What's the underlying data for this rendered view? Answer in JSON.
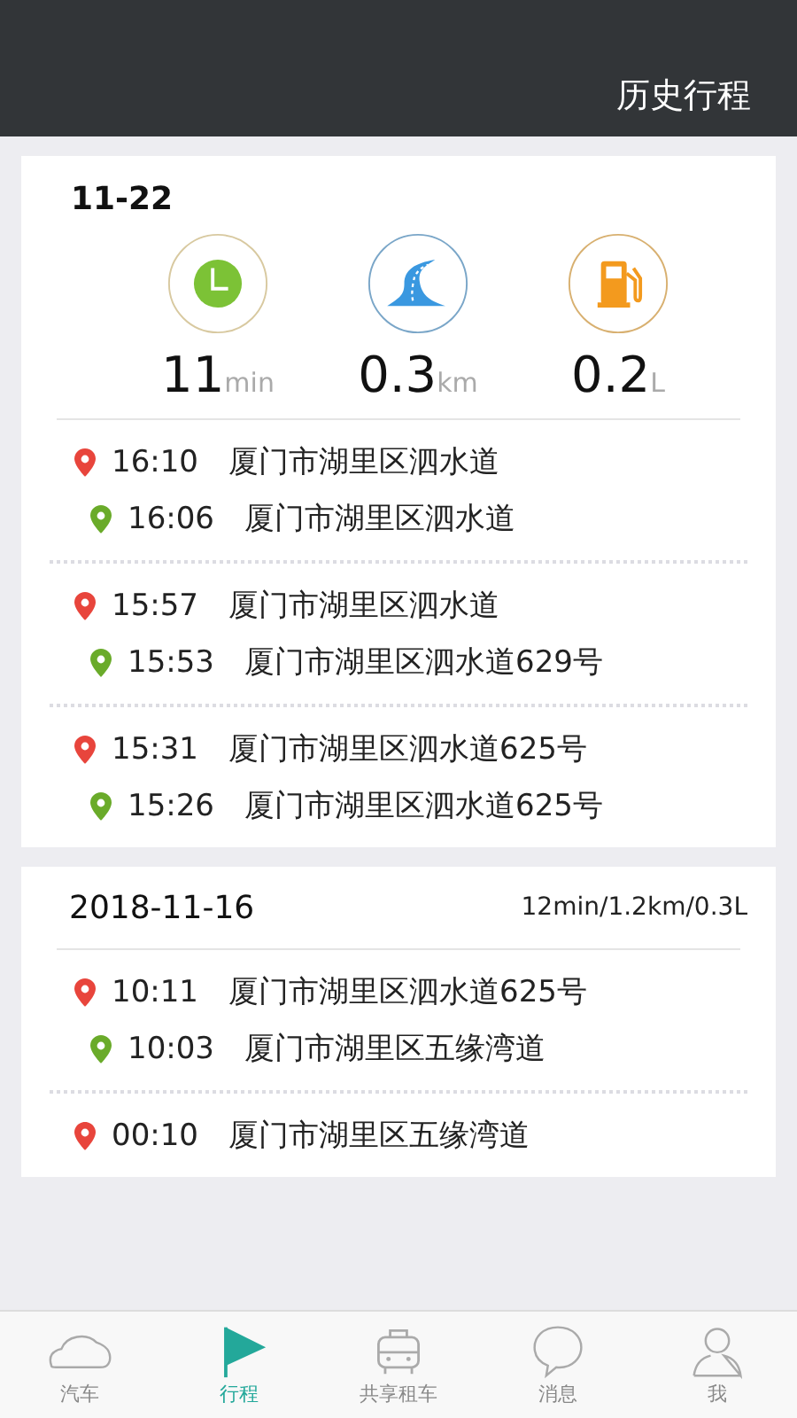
{
  "header": {
    "title": "历史行程"
  },
  "days": [
    {
      "date": "11-22",
      "kind": "summary",
      "stats": [
        {
          "kind": "clock",
          "value": "11",
          "unit": "min"
        },
        {
          "kind": "road",
          "value": "0.3",
          "unit": "km"
        },
        {
          "kind": "fuel",
          "value": "0.2",
          "unit": "L"
        }
      ],
      "trips": [
        {
          "points": [
            {
              "kind": "end",
              "time": "16:10",
              "place": "厦门市湖里区泗水道"
            },
            {
              "kind": "start",
              "time": "16:06",
              "place": "厦门市湖里区泗水道"
            }
          ]
        },
        {
          "points": [
            {
              "kind": "end",
              "time": "15:57",
              "place": "厦门市湖里区泗水道"
            },
            {
              "kind": "start",
              "time": "15:53",
              "place": "厦门市湖里区泗水道629号"
            }
          ]
        },
        {
          "points": [
            {
              "kind": "end",
              "time": "15:31",
              "place": "厦门市湖里区泗水道625号"
            },
            {
              "kind": "start",
              "time": "15:26",
              "place": "厦门市湖里区泗水道625号"
            }
          ]
        }
      ]
    },
    {
      "date": "2018-11-16",
      "kind": "compact",
      "totals": "12min/1.2km/0.3L",
      "trips": [
        {
          "points": [
            {
              "kind": "end",
              "time": "10:11",
              "place": "厦门市湖里区泗水道625号"
            },
            {
              "kind": "start",
              "time": "10:03",
              "place": "厦门市湖里区五缘湾道"
            }
          ]
        },
        {
          "points": [
            {
              "kind": "end",
              "time": "00:10",
              "place": "厦门市湖里区五缘湾道"
            }
          ]
        }
      ]
    }
  ],
  "tabs": [
    {
      "kind": "car",
      "label": "汽车",
      "selected": false
    },
    {
      "kind": "flag",
      "label": "行程",
      "selected": true
    },
    {
      "kind": "taxi",
      "label": "共享租车",
      "selected": false
    },
    {
      "kind": "chat",
      "label": "消息",
      "selected": false
    },
    {
      "kind": "person",
      "label": "我",
      "selected": false
    }
  ]
}
